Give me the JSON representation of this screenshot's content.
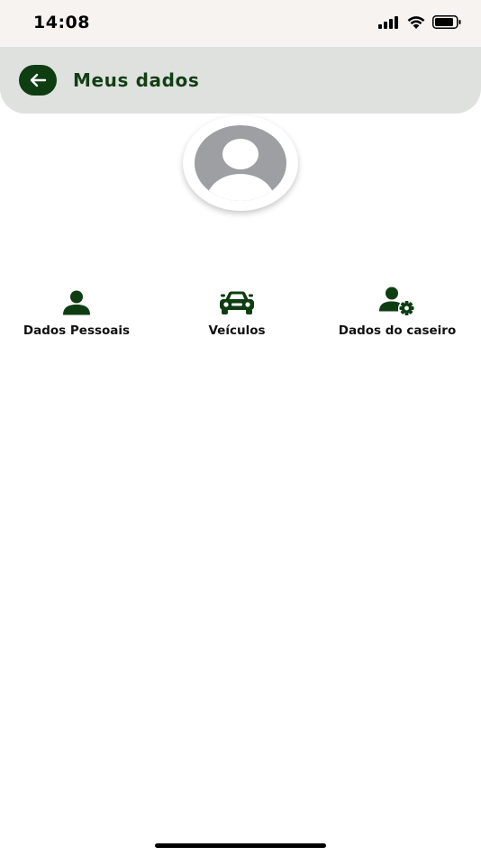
{
  "status_bar": {
    "time": "14:08"
  },
  "header": {
    "title": "Meus dados"
  },
  "menu": {
    "items": [
      {
        "label": "Dados Pessoais",
        "icon": "person-icon"
      },
      {
        "label": "Veículos",
        "icon": "car-icon"
      },
      {
        "label": "Dados do caseiro",
        "icon": "person-gear-icon"
      }
    ]
  },
  "colors": {
    "accent": "#0f3d12",
    "header_bg": "#dfe1df",
    "status_bg": "#f7f3f1"
  }
}
